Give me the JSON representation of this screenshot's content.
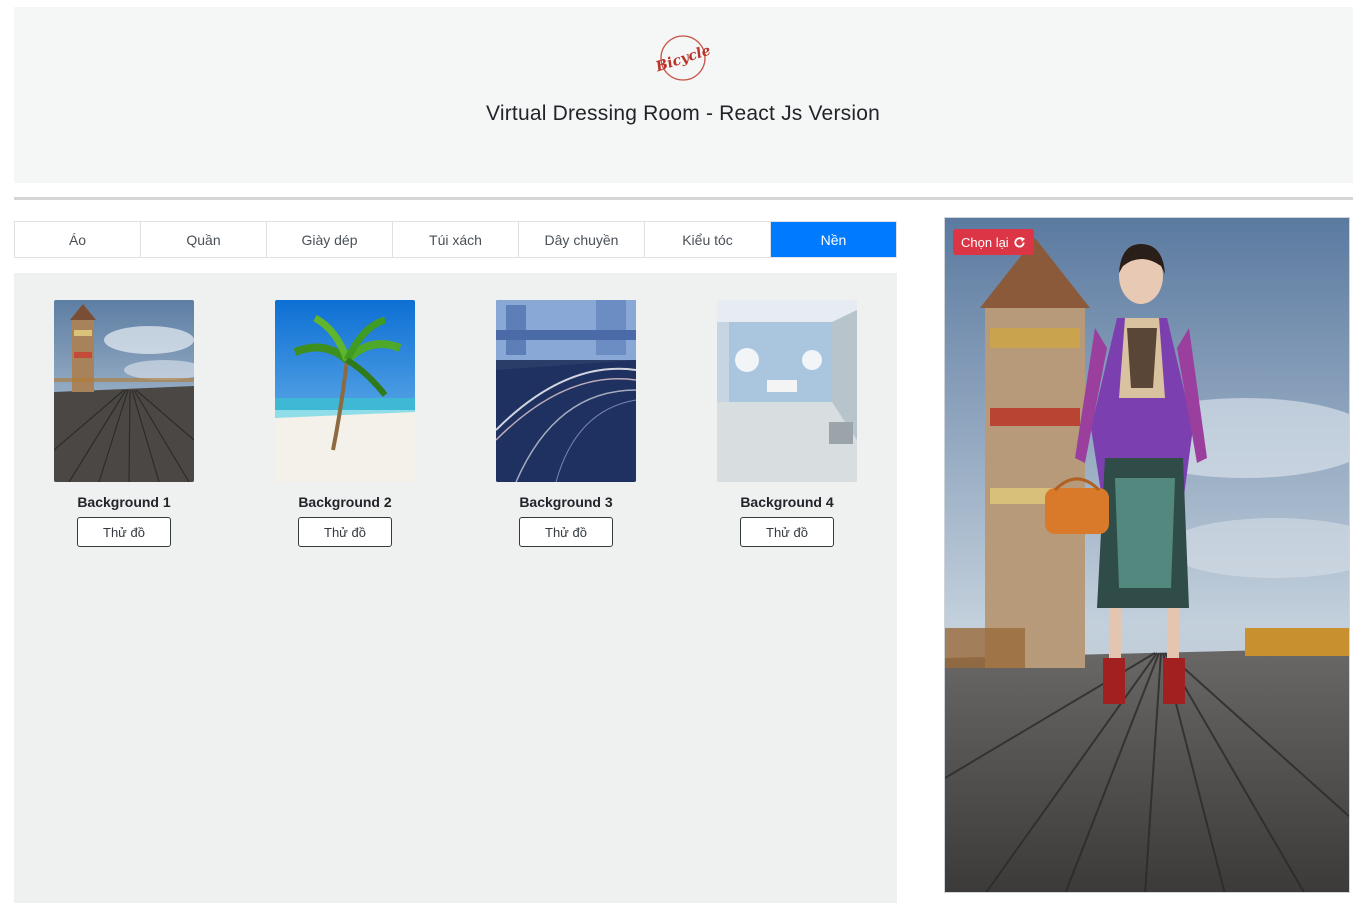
{
  "header": {
    "logo_text": "Bicycle",
    "title": "Virtual Dressing Room - React Js Version"
  },
  "tabs": [
    {
      "label": "Áo"
    },
    {
      "label": "Quần"
    },
    {
      "label": "Giày dép"
    },
    {
      "label": "Túi xách"
    },
    {
      "label": "Dây chuyền"
    },
    {
      "label": "Kiểu tóc"
    },
    {
      "label": "Nền",
      "active": true
    }
  ],
  "backgrounds": [
    {
      "name": "Background 1",
      "button": "Thử đồ",
      "image": "pier-tower"
    },
    {
      "name": "Background 2",
      "button": "Thử đồ",
      "image": "beach-palm"
    },
    {
      "name": "Background 3",
      "button": "Thử đồ",
      "image": "city-road"
    },
    {
      "name": "Background 4",
      "button": "Thử đồ",
      "image": "photo-studio"
    }
  ],
  "preview": {
    "reset_label": "Chọn lại",
    "reset_icon": "refresh-icon",
    "background": "pier-tower"
  },
  "colors": {
    "active_tab": "#007bff",
    "reset_button": "#dc3545",
    "panel_bg": "#eff0f0",
    "header_bg": "#f5f6f6"
  }
}
